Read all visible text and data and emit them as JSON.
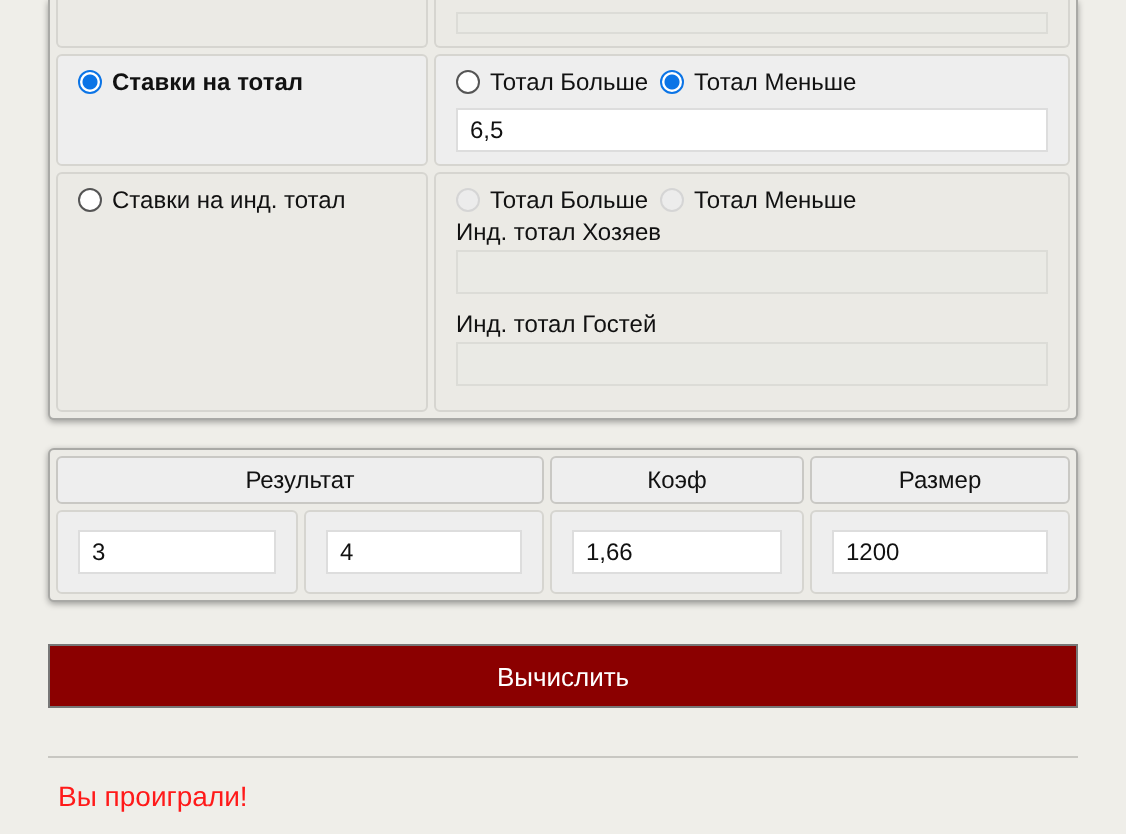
{
  "bet_rows": [
    {
      "kind": "cut",
      "field": {
        "disabled": true
      }
    },
    {
      "kind": "bet",
      "option": {
        "label": "Ставки на тотал",
        "selected": true
      },
      "choices": [
        {
          "label": "Тотал Больше",
          "selected": false,
          "disabled": false
        },
        {
          "label": "Тотал Меньше",
          "selected": true,
          "disabled": false
        }
      ],
      "fields": [
        {
          "value": "6,5",
          "disabled": false
        }
      ]
    },
    {
      "kind": "bet",
      "option": {
        "label": "Ставки на инд. тотал",
        "selected": false
      },
      "choices": [
        {
          "label": "Тотал Больше",
          "selected": false,
          "disabled": true
        },
        {
          "label": "Тотал Меньше",
          "selected": false,
          "disabled": true
        }
      ],
      "fields": [
        {
          "label": "Инд. тотал Хозяев",
          "disabled": true
        },
        {
          "label": "Инд. тотал Гостей",
          "disabled": true
        }
      ]
    }
  ],
  "results": {
    "headers": [
      "Результат",
      "Коэф",
      "Размер"
    ],
    "values": [
      "3",
      "4",
      "1,66",
      "1200"
    ]
  },
  "calculate_button": "Вычислить",
  "message": "Вы проиграли!"
}
